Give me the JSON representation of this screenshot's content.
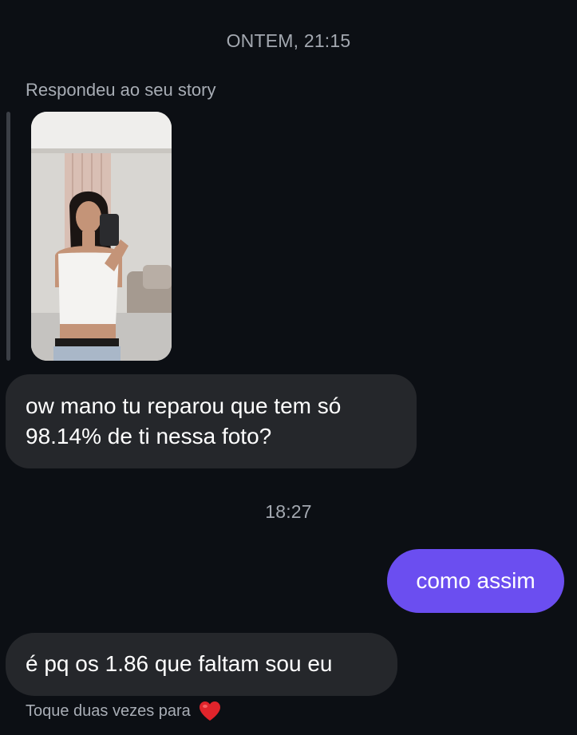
{
  "thread": {
    "timestamp_1": "ONTEM, 21:15",
    "reply_context": "Respondeu ao seu story",
    "story_image": "story-photo-thumbnail",
    "messages": [
      {
        "direction": "incoming",
        "text": "ow mano tu reparou que tem só\n98.14% de ti nessa foto?"
      },
      {
        "direction": "outgoing",
        "text": "como assim"
      },
      {
        "direction": "incoming",
        "text": "é pq os 1.86 que faltam sou eu"
      }
    ],
    "timestamp_2": "18:27",
    "footer_hint": "Toque duas vezes para",
    "footer_icon": "heart-icon"
  },
  "colors": {
    "background": "#0c0f14",
    "incoming_bubble": "#25272b",
    "outgoing_bubble": "#6b4ef0",
    "meta_text": "#a3a8b0",
    "heart": "#e0242b"
  }
}
